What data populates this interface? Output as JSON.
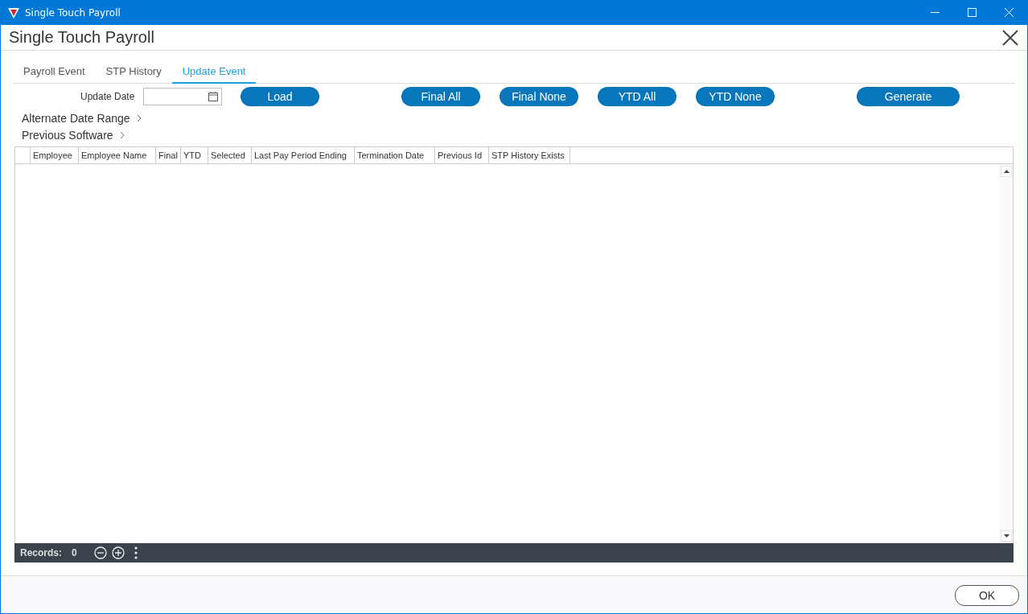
{
  "window": {
    "title": "Single Touch Payroll"
  },
  "header": {
    "title": "Single Touch Payroll"
  },
  "tabs": [
    {
      "label": "Payroll Event",
      "selected": false
    },
    {
      "label": "STP History",
      "selected": false
    },
    {
      "label": "Update Event",
      "selected": true
    }
  ],
  "update_date": {
    "label": "Update Date"
  },
  "buttons": [
    {
      "label": "Load"
    },
    {
      "label": "Final All"
    },
    {
      "label": "Final None"
    },
    {
      "label": "YTD All"
    },
    {
      "label": "YTD None"
    },
    {
      "label": "Generate"
    }
  ],
  "sections": [
    {
      "label": "Alternate Date Range",
      "expanded": false
    },
    {
      "label": "Previous Software",
      "expanded": false
    }
  ],
  "table": {
    "columns": [
      "Employee",
      "Employee Name",
      "Final",
      "YTD",
      "Selected",
      "Last Pay Period Ending",
      "Termination Date",
      "Previous Id",
      "STP History Exists"
    ]
  },
  "footer": {
    "records_label": "Records:",
    "records_count": "0"
  },
  "ok_button": "OK"
}
